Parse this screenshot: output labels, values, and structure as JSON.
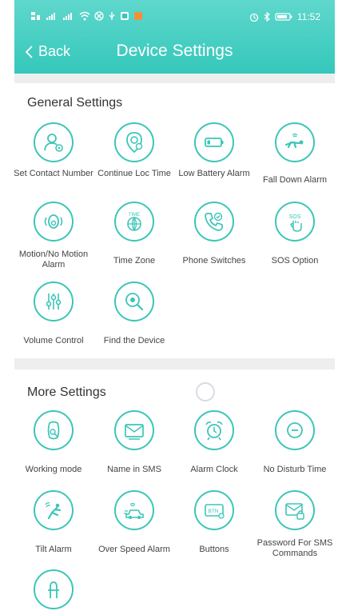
{
  "header": {
    "back_label": "Back",
    "title": "Device Settings",
    "clock": "11:52"
  },
  "general": {
    "title": "General Settings",
    "items": [
      {
        "label": "Set Contact Number",
        "icon": "contact-settings-icon"
      },
      {
        "label": "Continue Loc Time",
        "icon": "location-pin-icon"
      },
      {
        "label": "Low Battery Alarm",
        "icon": "battery-icon"
      },
      {
        "label": "Fall Down Alarm",
        "icon": "fall-person-icon"
      },
      {
        "label": "Motion/No Motion Alarm",
        "icon": "motion-icon"
      },
      {
        "label": "Time Zone",
        "icon": "globe-icon"
      },
      {
        "label": "Phone Switches",
        "icon": "phone-icon"
      },
      {
        "label": "SOS Option",
        "icon": "sos-hand-icon"
      },
      {
        "label": "Volume Control",
        "icon": "sliders-icon"
      },
      {
        "label": "Find the Device",
        "icon": "search-target-icon"
      }
    ]
  },
  "more": {
    "title": "More Settings",
    "items": [
      {
        "label": "Working mode",
        "icon": "device-search-icon"
      },
      {
        "label": "Name in SMS",
        "icon": "envelope-icon"
      },
      {
        "label": "Alarm Clock",
        "icon": "alarm-clock-icon"
      },
      {
        "label": "No Disturb Time",
        "icon": "minus-circle-icon"
      },
      {
        "label": "Tilt Alarm",
        "icon": "tilt-person-icon"
      },
      {
        "label": "Over Speed Alarm",
        "icon": "car-icon"
      },
      {
        "label": "Buttons",
        "icon": "btn-icon"
      },
      {
        "label": "Password For SMS Commands",
        "icon": "envelope-lock-icon"
      },
      {
        "label": "",
        "icon": "plug-icon"
      }
    ]
  },
  "icon_text": {
    "btn": "BTN",
    "sos": "SOS",
    "time": "TIME"
  },
  "colors": {
    "accent": "#3cc5b8",
    "header": "#35c8bb"
  }
}
